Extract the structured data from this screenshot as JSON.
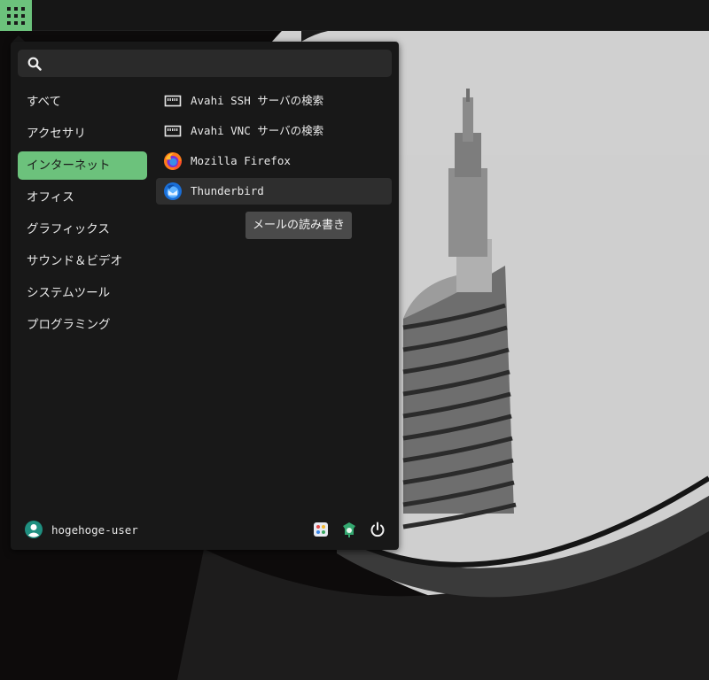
{
  "search": {
    "placeholder": "",
    "icon": "search-icon"
  },
  "categories": [
    {
      "label": "すべて",
      "active": false
    },
    {
      "label": "アクセサリ",
      "active": false
    },
    {
      "label": "インターネット",
      "active": true
    },
    {
      "label": "オフィス",
      "active": false
    },
    {
      "label": "グラフィックス",
      "active": false
    },
    {
      "label": "サウンド＆ビデオ",
      "active": false
    },
    {
      "label": "システムツール",
      "active": false
    },
    {
      "label": "プログラミング",
      "active": false
    }
  ],
  "apps": [
    {
      "label": "Avahi SSH サーバの検索",
      "icon": "network-icon"
    },
    {
      "label": "Avahi VNC サーバの検索",
      "icon": "network-icon"
    },
    {
      "label": "Mozilla Firefox",
      "icon": "firefox-icon"
    },
    {
      "label": "Thunderbird",
      "icon": "thunderbird-icon",
      "hovered": true
    }
  ],
  "tooltip": "メールの読み書き",
  "user": {
    "name": "hogehoge-user",
    "icon": "user-avatar-icon"
  },
  "footer_buttons": [
    "settings-icon",
    "software-icon",
    "power-icon"
  ],
  "colors": {
    "accent": "#6cc27c",
    "menu_bg": "#181818",
    "panel_bg": "#161616"
  }
}
